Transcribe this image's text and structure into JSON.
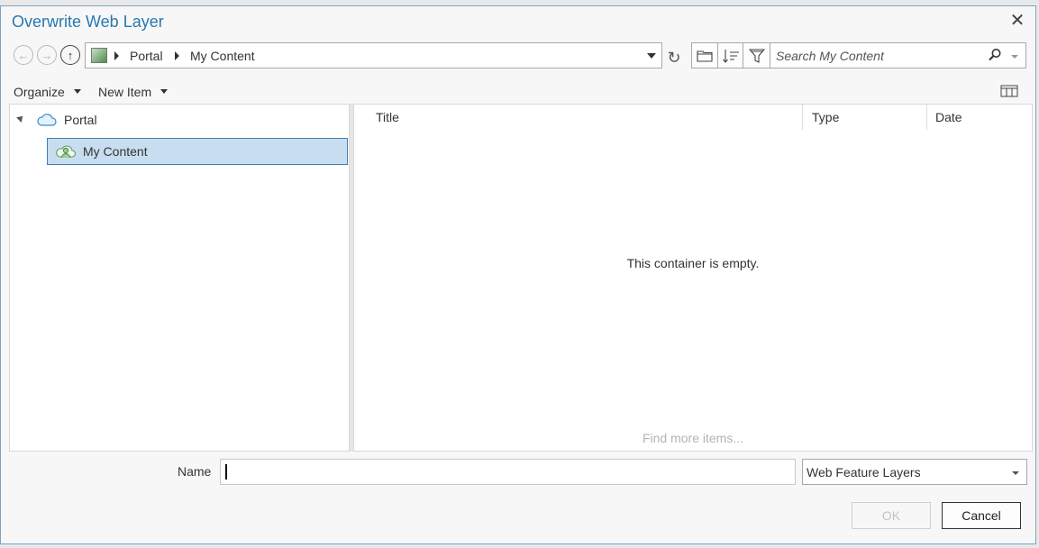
{
  "window": {
    "title": "Overwrite Web Layer"
  },
  "navigation": {
    "breadcrumbs": [
      "Portal",
      "My Content"
    ]
  },
  "search": {
    "placeholder": "Search My Content"
  },
  "menubar": {
    "organize": "Organize",
    "new_item": "New Item"
  },
  "tree": {
    "items": [
      {
        "label": "Portal"
      },
      {
        "label": "My Content"
      }
    ]
  },
  "content": {
    "columns": [
      "Title",
      "Type",
      "Date"
    ],
    "empty_message": "This container is empty.",
    "find_more": "Find more items..."
  },
  "footer": {
    "name_label": "Name",
    "name_value": "",
    "type_selected": "Web Feature Layers",
    "ok_label": "OK",
    "cancel_label": "Cancel"
  },
  "icons": {
    "back": "back-arrow-icon",
    "forward": "forward-arrow-icon",
    "up": "up-arrow-icon",
    "refresh": "refresh-icon",
    "folder": "folder-icon",
    "sort": "sort-icon",
    "filter": "filter-icon",
    "search": "search-icon",
    "view": "view-options-icon",
    "portal": "cloud-icon",
    "my_content": "user-cloud-icon"
  },
  "colors": {
    "title": "#2878b0",
    "selection_fill": "#c8def0",
    "selection_border": "#3f7fb5"
  }
}
